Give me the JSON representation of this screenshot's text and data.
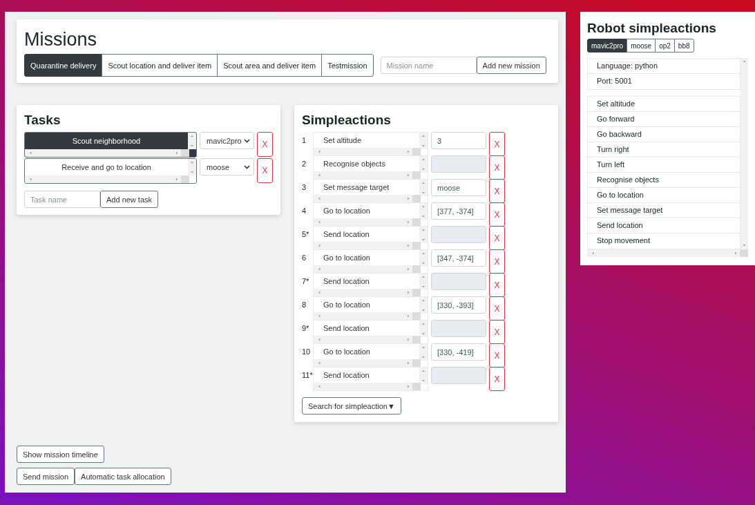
{
  "missions": {
    "title": "Missions",
    "tabs": [
      {
        "label": "Quarantine delivery",
        "selected": true
      },
      {
        "label": "Scout location and deliver item",
        "selected": false
      },
      {
        "label": "Scout area and deliver item",
        "selected": false
      },
      {
        "label": "Testmission",
        "selected": false
      }
    ],
    "name_field": {
      "placeholder": "Mission name"
    },
    "add_button": "Add new mission"
  },
  "tasks": {
    "title": "Tasks",
    "items": [
      {
        "name": "Scout neighborhood",
        "selected": true,
        "robot": "mavic2pro",
        "delete": "X"
      },
      {
        "name": "Receive and go to location",
        "selected": false,
        "robot": "moose",
        "delete": "X"
      }
    ],
    "name_field": {
      "placeholder": "Task name"
    },
    "add_button": "Add new task"
  },
  "simpleactions": {
    "title": "Simpleactions",
    "items": [
      {
        "number": "1",
        "name": "Set altitude",
        "value": "3",
        "disabled": false,
        "delete": "X"
      },
      {
        "number": "2",
        "name": "Recognise objects",
        "disabled": true,
        "delete": "X"
      },
      {
        "number": "3",
        "name": "Set message target",
        "value": "moose",
        "disabled": false,
        "delete": "X"
      },
      {
        "number": "4",
        "name": "Go to location",
        "value": "[377, -374]",
        "disabled": false,
        "delete": "X"
      },
      {
        "number": "5*",
        "name": "Send location",
        "disabled": true,
        "delete": "X"
      },
      {
        "number": "6",
        "name": "Go to location",
        "value": "[347, -374]",
        "disabled": false,
        "delete": "X"
      },
      {
        "number": "7*",
        "name": "Send location",
        "disabled": true,
        "delete": "X"
      },
      {
        "number": "8",
        "name": "Go to location",
        "value": "[330, -393]",
        "disabled": false,
        "delete": "X"
      },
      {
        "number": "9*",
        "name": "Send location",
        "disabled": true,
        "delete": "X"
      },
      {
        "number": "10",
        "name": "Go to location",
        "value": "[330, -419]",
        "disabled": false,
        "delete": "X"
      },
      {
        "number": "11*",
        "name": "Send location",
        "disabled": true,
        "delete": "X"
      }
    ],
    "search_button": "Search for simpleaction▼"
  },
  "bottom_buttons": [
    [
      "Show mission timeline"
    ],
    [
      "Send mission",
      "Automatic task allocation"
    ]
  ],
  "robot": {
    "title": "Robot simpleactions",
    "tabs": [
      {
        "label": "mavic2pro",
        "selected": true
      },
      {
        "label": "moose",
        "selected": false
      },
      {
        "label": "op2",
        "selected": false
      },
      {
        "label": "bb8",
        "selected": false
      }
    ],
    "info": [
      "Language: python",
      "Port: 5001"
    ],
    "actions": [
      "Set altitude",
      "Go forward",
      "Go backward",
      "Turn right",
      "Turn left",
      "Recognise objects",
      "Go to location",
      "Set message target",
      "Send location",
      "Stop movement"
    ]
  }
}
